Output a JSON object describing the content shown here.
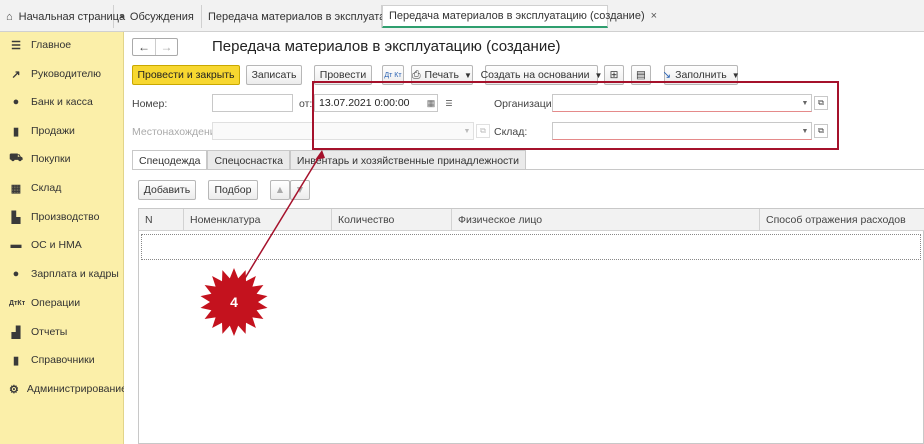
{
  "tabs": [
    {
      "label": "Начальная страница",
      "icon": "home-icon"
    },
    {
      "label": "Обсуждения",
      "icon": "discussion-icon"
    },
    {
      "label": "Передача материалов в эксплуатацию",
      "icon": "close-icon"
    },
    {
      "label": "Передача материалов в эксплуатацию (создание)",
      "icon": "close-icon"
    }
  ],
  "sidebar": {
    "items": [
      {
        "label": "Главное",
        "icon": "menu-icon"
      },
      {
        "label": "Руководителю",
        "icon": "trend-icon"
      },
      {
        "label": "Банк и касса",
        "icon": "coin-icon"
      },
      {
        "label": "Продажи",
        "icon": "bag-icon"
      },
      {
        "label": "Покупки",
        "icon": "cart-icon"
      },
      {
        "label": "Склад",
        "icon": "warehouse-icon"
      },
      {
        "label": "Производство",
        "icon": "factory-icon"
      },
      {
        "label": "ОС и НМА",
        "icon": "truck-icon"
      },
      {
        "label": "Зарплата и кадры",
        "icon": "person-icon"
      },
      {
        "label": "Операции",
        "icon": "dt-kt-icon"
      },
      {
        "label": "Отчеты",
        "icon": "bar-chart-icon"
      },
      {
        "label": "Справочники",
        "icon": "book-icon"
      },
      {
        "label": "Администрирование",
        "icon": "gear-icon"
      }
    ]
  },
  "form": {
    "title": "Передача материалов в эксплуатацию (создание)",
    "toolbar": {
      "post_close": "Провести и закрыть",
      "save": "Записать",
      "post": "Провести",
      "dtkt": "Дт Кт",
      "print": "Печать",
      "create_based": "Создать на основании",
      "fill": "Заполнить"
    },
    "fields": {
      "number_label": "Номер:",
      "number_value": "",
      "date_label": "от:",
      "date_value": "13.07.2021  0:00:00",
      "org_label": "Организация:",
      "org_value": "",
      "location_label": "Местонахождение:",
      "location_value": "",
      "warehouse_label": "Склад:",
      "warehouse_value": ""
    },
    "tabs": [
      {
        "label": "Спецодежда"
      },
      {
        "label": "Спецоснастка"
      },
      {
        "label": "Инвентарь и хозяйственные принадлежности"
      }
    ],
    "table_toolbar": {
      "add": "Добавить",
      "select": "Подбор"
    },
    "columns": [
      "N",
      "Номенклатура",
      "Количество",
      "Физическое лицо",
      "Способ отражения расходов"
    ]
  },
  "annotation": {
    "badge": "4",
    "color": "#a5112b"
  }
}
